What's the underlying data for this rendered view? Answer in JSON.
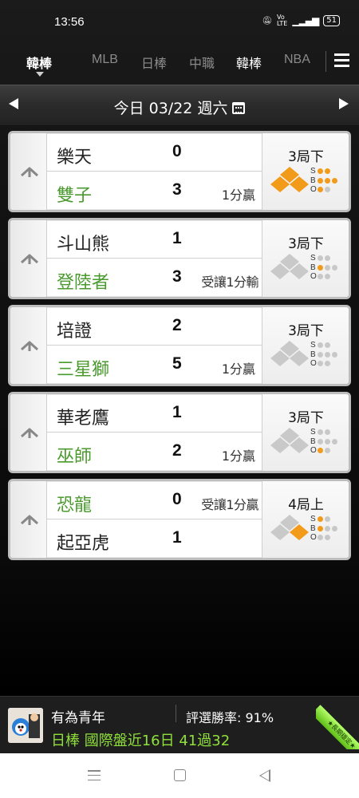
{
  "status_bar": {
    "time": "13:56",
    "battery": "51"
  },
  "tabs": [
    {
      "label": "韓棒",
      "active": true
    },
    {
      "label": "MLB",
      "active": false
    },
    {
      "label": "日棒",
      "active": false
    },
    {
      "label": "中職",
      "active": false
    },
    {
      "label": "韓棒",
      "active": false
    },
    {
      "label": "NBA",
      "active": false
    }
  ],
  "date_bar": {
    "label": "今日 03/22 週六"
  },
  "games": [
    {
      "team1": "樂天",
      "score1": "0",
      "result1": "",
      "team2": "雙子",
      "score2": "3",
      "result2": "1分贏",
      "inning": "3局下",
      "bases": {
        "first": true,
        "second": true,
        "third": true
      },
      "count": {
        "s": 2,
        "b": 3,
        "o": 1
      }
    },
    {
      "team1": "斗山熊",
      "score1": "1",
      "result1": "",
      "team2": "登陸者",
      "score2": "3",
      "result2": "受讓1分輸",
      "inning": "3局下",
      "bases": {
        "first": false,
        "second": false,
        "third": false
      },
      "count": {
        "s": 0,
        "b": 1,
        "o": 0
      }
    },
    {
      "team1": "培證",
      "score1": "2",
      "result1": "",
      "team2": "三星獅",
      "score2": "5",
      "result2": "1分贏",
      "inning": "3局下",
      "bases": {
        "first": false,
        "second": false,
        "third": false
      },
      "count": {
        "s": 0,
        "b": 0,
        "o": 0
      }
    },
    {
      "team1": "華老鷹",
      "score1": "1",
      "result1": "",
      "team2": "巫師",
      "score2": "2",
      "result2": "1分贏",
      "inning": "3局下",
      "bases": {
        "first": false,
        "second": false,
        "third": false
      },
      "count": {
        "s": 0,
        "b": 0,
        "o": 1
      }
    },
    {
      "team1": "恐龍",
      "score1": "0",
      "result1": "受讓1分贏",
      "team2": "起亞虎",
      "score2": "1",
      "result2": "",
      "inning": "4局上",
      "bases": {
        "first": true,
        "second": false,
        "third": false
      },
      "count": {
        "s": 1,
        "b": 1,
        "o": 0
      },
      "home_first": true
    }
  ],
  "footer": {
    "username": "有為青年",
    "rate_label": "評選勝率: 91%",
    "stats": "日棒 國際盤近16日 41過32",
    "ribbon": "長期穩定"
  },
  "colors": {
    "home_team": "#4a9a2e",
    "base_on": "#f29a1a",
    "stats_green": "#8fe03a"
  }
}
